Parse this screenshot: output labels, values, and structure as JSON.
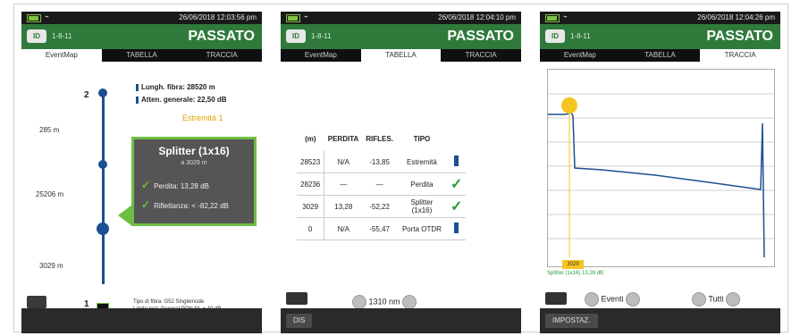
{
  "colors": {
    "header_green": "#2f7a3b",
    "check_green": "#2c9a3a",
    "event_blue": "#1c4f93",
    "marker_yellow": "#f7c51e",
    "callout_border": "#6fbe44"
  },
  "screens": [
    {
      "time": "26/06/2018 12:03:56 pm",
      "fiber_id": "1-8-11",
      "result": "PASSATO",
      "tabs": [
        "EventMap",
        "TABELLA",
        "TRACCIA"
      ],
      "active_tab": 0,
      "fiber_length": "Lungh. fibra: 28520 m",
      "total_loss": "Atten. generale: 22,50 dB",
      "end_label": "Estremità 1",
      "event_top": "2",
      "event_bottom": "1",
      "distances": [
        "285 m",
        "25206 m",
        "3029 m"
      ],
      "callout": {
        "title": "Splitter (1x16)",
        "subtitle": "a 3029 m",
        "loss": "Perdita: 13,28 dB",
        "reflectance": "Riflettanza: < -82,22 dB"
      },
      "fibre_type_line1": "Tipo di fibra: G52 Singlemode",
      "fibre_type_line2": "Limite test: General PON NL + 40 dB"
    },
    {
      "time": "26/06/2018 12:04:10 pm",
      "fiber_id": "1-8-11",
      "result": "PASSATO",
      "tabs": [
        "EventMap",
        "TABELLA",
        "TRACCIA"
      ],
      "active_tab": 1,
      "table_headers": [
        "(m)",
        "PERDITA",
        "RIFLES.",
        "TIPO"
      ],
      "rows": [
        {
          "dist": "28523",
          "loss": "N/A",
          "refl": "-13,85",
          "type": "Estremità",
          "status": "info"
        },
        {
          "dist": "28236",
          "loss": "—",
          "refl": "—",
          "type": "Perdita",
          "status": "ok"
        },
        {
          "dist": "3029",
          "loss": "13,28",
          "refl": "-52,22",
          "type": "Splitter (1x16)",
          "status": "ok"
        },
        {
          "dist": "0",
          "loss": "N/A",
          "refl": "-55,47",
          "type": "Porta OTDR",
          "status": "info"
        }
      ],
      "wavelength": "1310 nm",
      "softkey": "DIS"
    },
    {
      "time": "26/06/2018 12:04:26 pm",
      "fiber_id": "1-8-11",
      "result": "PASSATO",
      "tabs": [
        "EventMap",
        "TABELLA",
        "TRACCIA"
      ],
      "active_tab": 2,
      "marker_value": "3029",
      "trace_caption": "Splitter (1x16) 13,28 dB",
      "events_label": "Eventi",
      "all_label": "Tutti",
      "softkey": "IMPOSTAZ."
    }
  ]
}
